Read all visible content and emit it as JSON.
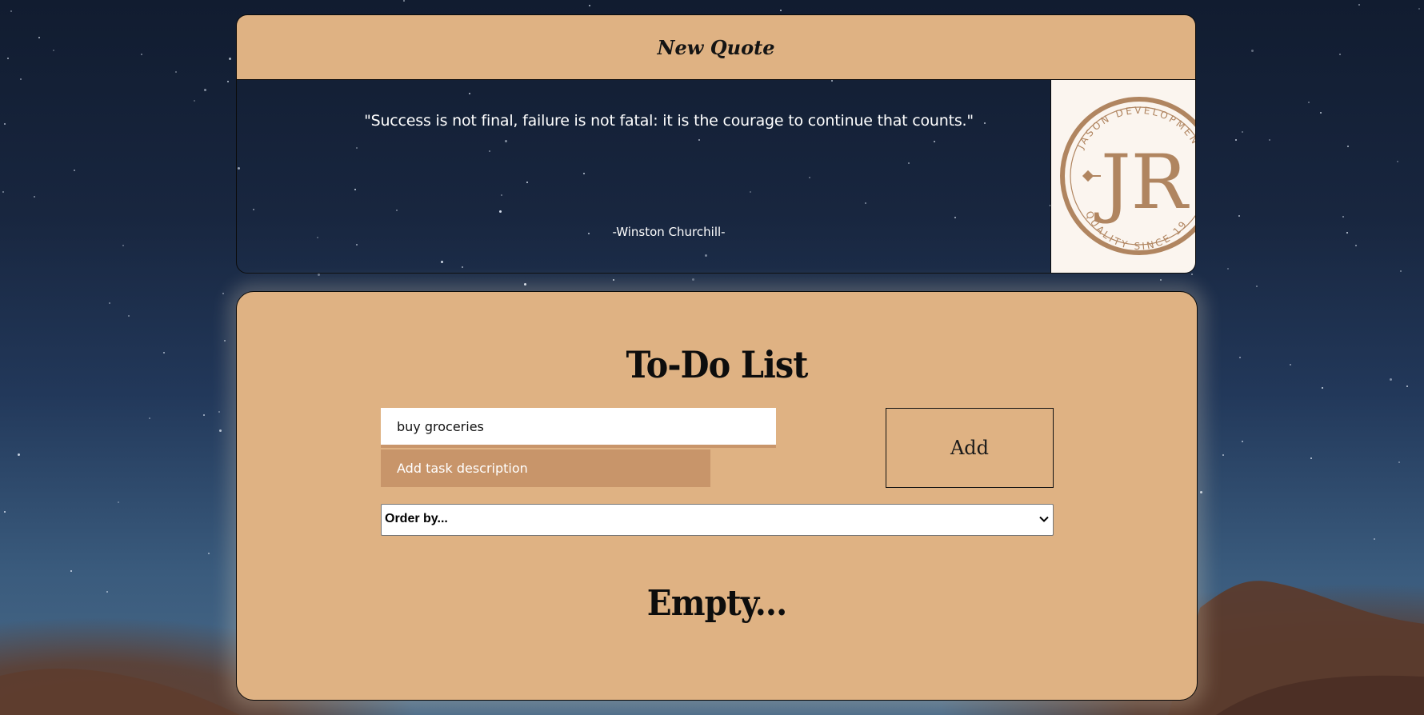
{
  "quote": {
    "new_quote_label": "New Quote",
    "text": "\"Success is not final, failure is not fatal: it is the courage to continue that counts.\"",
    "author": "-Winston Churchill-",
    "logo": {
      "monogram": "JR",
      "ring_top_text": "JASON DEVELOPMENT",
      "ring_bottom_text": "QUALITY SINCE 19",
      "color": "#b08560"
    }
  },
  "todo": {
    "title": "To-Do List",
    "task_title_value": "buy groceries",
    "task_description_placeholder": "Add task description",
    "add_label": "Add",
    "order_by_selected": "Order by...",
    "empty_message": "Empty..."
  },
  "colors": {
    "card_tan": "#dfb283",
    "accent_brown": "#c8956a",
    "logo_bg": "#fbf5ef"
  }
}
